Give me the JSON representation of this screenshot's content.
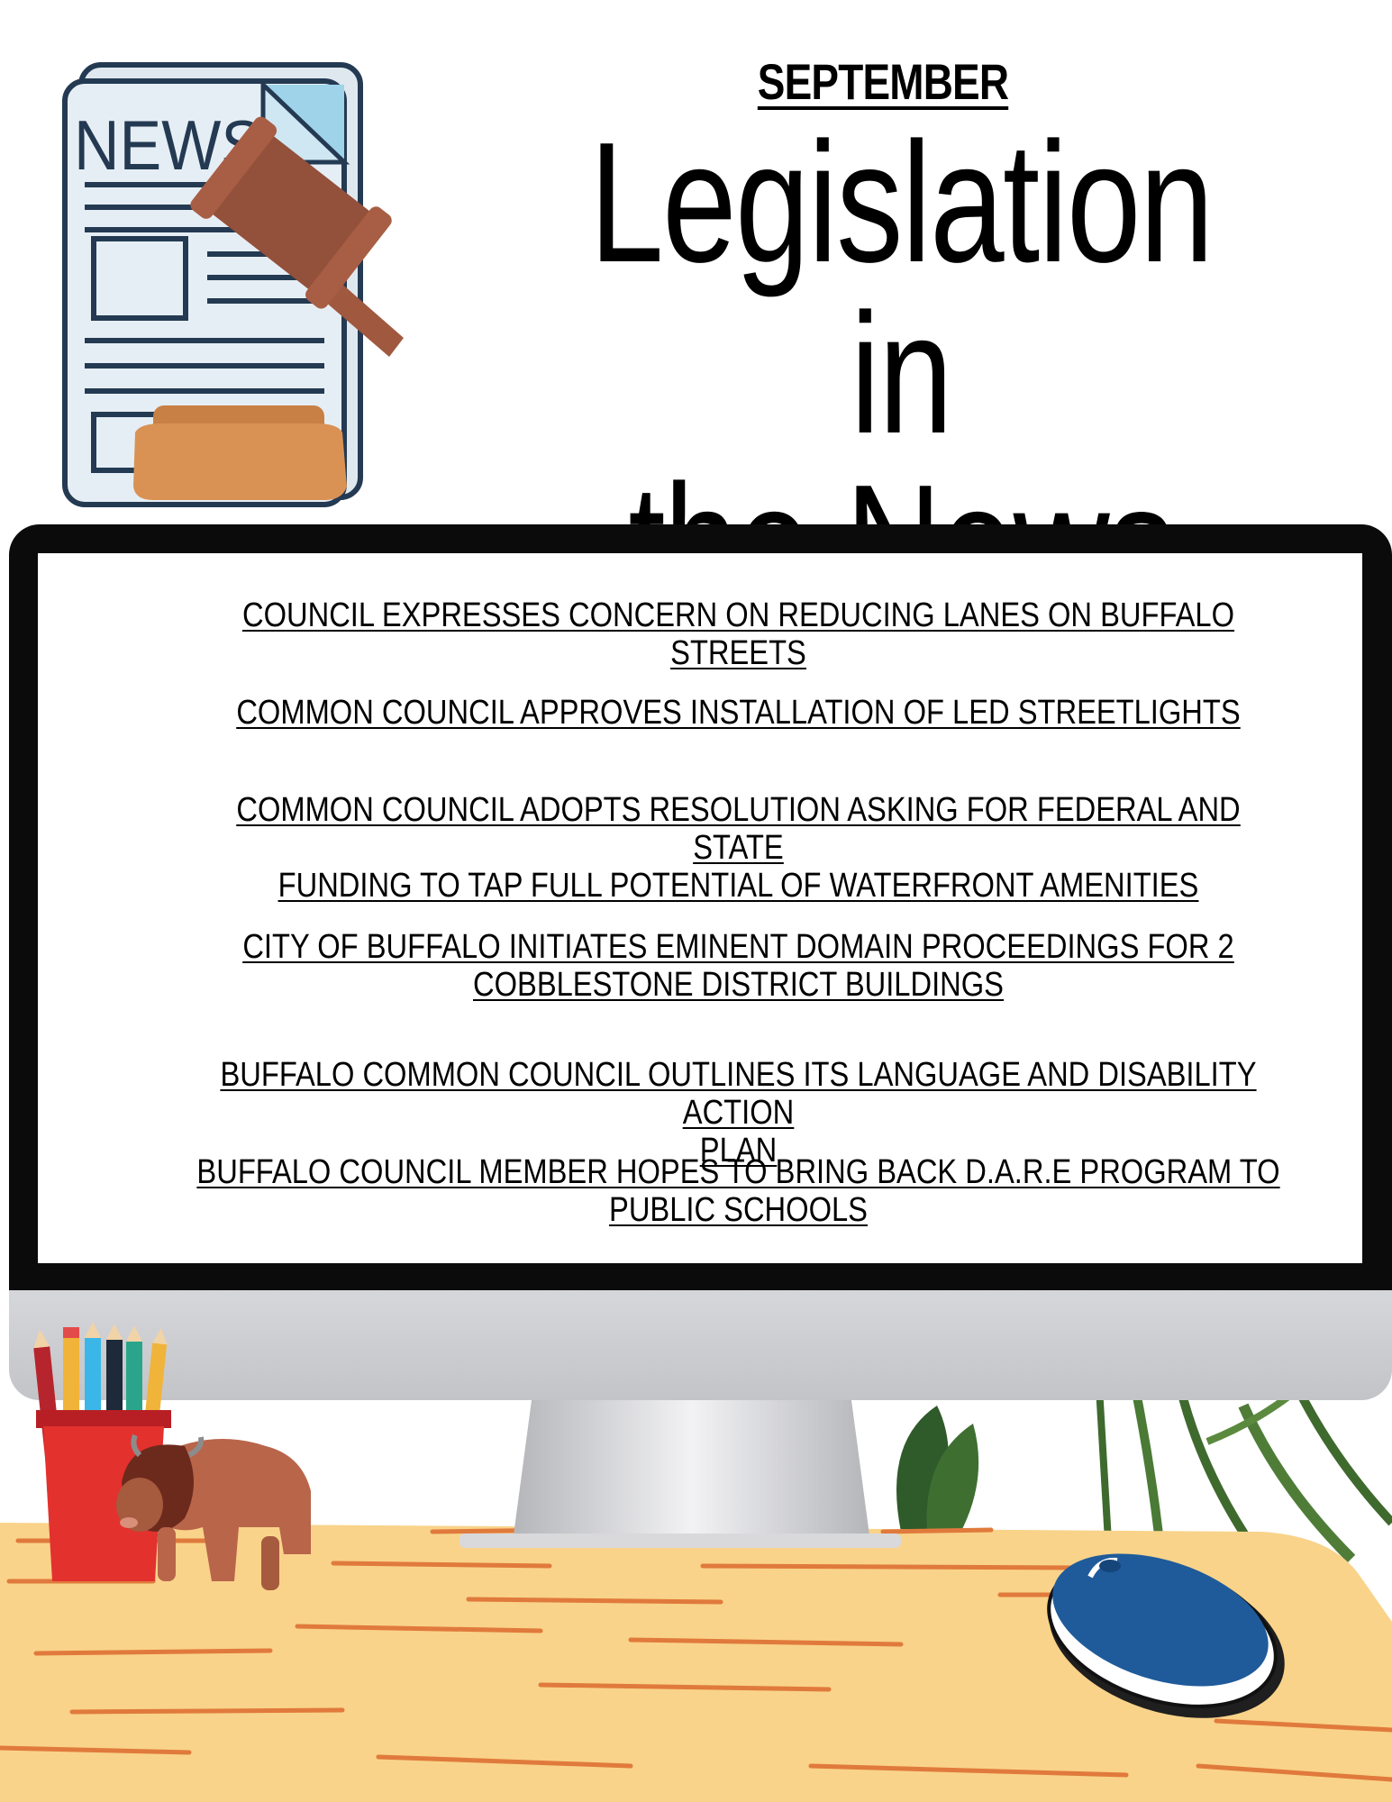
{
  "header": {
    "month": "SEPTEMBER",
    "title_line1": "Legislation in",
    "title_line2": "the News"
  },
  "newspaper_icon": {
    "label": "NEWS"
  },
  "headlines": [
    {
      "text": "COUNCIL EXPRESSES CONCERN ON REDUCING LANES ON BUFFALO STREETS"
    },
    {
      "text": "COMMON COUNCIL APPROVES INSTALLATION OF LED STREETLIGHTS"
    },
    {
      "line1": "COMMON COUNCIL ADOPTS RESOLUTION ASKING FOR FEDERAL AND STATE",
      "line2": "FUNDING TO TAP FULL POTENTIAL OF WATERFRONT AMENITIES"
    },
    {
      "line1": "CITY OF BUFFALO INITIATES EMINENT DOMAIN PROCEEDINGS FOR 2",
      "line2": "COBBLESTONE DISTRICT BUILDINGS"
    },
    {
      "line1": "BUFFALO COMMON COUNCIL OUTLINES ITS LANGUAGE AND DISABILITY ACTION",
      "line2": "PLAN"
    },
    {
      "line1": "BUFFALO COUNCIL MEMBER HOPES TO BRING BACK D.A.R.E PROGRAM TO",
      "line2": "PUBLIC SCHOOLS"
    }
  ],
  "colors": {
    "desk": "#f9d38a",
    "desk_grain": "#e07a3c",
    "gavel": "#a0583f",
    "gavel_base": "#d4935a",
    "mouse": "#1f5b9b",
    "cup": "#e3312e",
    "bison": "#b9654a",
    "plant": "#3f6a2e"
  }
}
